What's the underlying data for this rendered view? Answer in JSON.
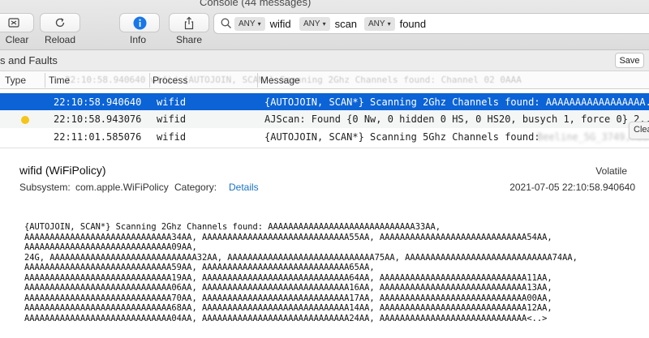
{
  "window": {
    "title": "Console (44 messages)"
  },
  "toolbar": {
    "clear_label": "Clear",
    "reload_label": "Reload",
    "info_label": "Info",
    "share_label": "Share"
  },
  "search": {
    "tokens": [
      {
        "scope": "ANY",
        "text": "wifid"
      },
      {
        "scope": "ANY",
        "text": "scan"
      },
      {
        "scope": "ANY",
        "text": "found"
      }
    ]
  },
  "header": {
    "faults_label": "s and Faults",
    "save_label": "Save"
  },
  "table": {
    "columns": [
      "Type",
      "Time",
      "Process",
      "Message"
    ],
    "rows": [
      {
        "type": "",
        "time": "22:10:58.940640",
        "process": "wifid",
        "message": "{AUTOJOIN, SCAN*} Scanning 2Ghz Channels found: AAAAAAAAAAAAAAAAA..."
      },
      {
        "type": "yellow-dot",
        "time": "22:10:58.943076",
        "process": "wifid",
        "message": "AJScan: Found {0 Nw, 0 hidden 0 HS, 0 HS20, busych 1, force 0} 2..."
      },
      {
        "type": "",
        "time": "22:11:01.585076",
        "process": "wifid",
        "message": "{AUTOJOIN, SCAN*} Scanning 5Ghz Channels found:"
      }
    ]
  },
  "details": {
    "title": "wifid (WiFiPolicy)",
    "volatile": "Volatile",
    "subsystem_label": "Subsystem:",
    "subsystem_value": "com.apple.WiFiPolicy",
    "category_label": "Category:",
    "details_link": "Details",
    "timestamp": "2021-07-05 22:10:58.940640",
    "message_lines": [
      "{AUTOJOIN, SCAN*} Scanning 2Ghz Channels found: AAAAAAAAAAAAAAAAAAAAAAAAAAAAA33AA,",
      "AAAAAAAAAAAAAAAAAAAAAAAAAAAAA34AA, AAAAAAAAAAAAAAAAAAAAAAAAAAAAA55AA, AAAAAAAAAAAAAAAAAAAAAAAAAAAAA54AA,",
      "AAAAAAAAAAAAAAAAAAAAAAAAAAAAA09AA,",
      "24G, AAAAAAAAAAAAAAAAAAAAAAAAAAAAA32AA, AAAAAAAAAAAAAAAAAAAAAAAAAAAAA75AA, AAAAAAAAAAAAAAAAAAAAAAAAAAAAA74AA,",
      "AAAAAAAAAAAAAAAAAAAAAAAAAAAAA59AA, AAAAAAAAAAAAAAAAAAAAAAAAAAAAA65AA,",
      "AAAAAAAAAAAAAAAAAAAAAAAAAAAAA19AA, AAAAAAAAAAAAAAAAAAAAAAAAAAAAA64AA, AAAAAAAAAAAAAAAAAAAAAAAAAAAAA11AA,",
      "AAAAAAAAAAAAAAAAAAAAAAAAAAAAA06AA, AAAAAAAAAAAAAAAAAAAAAAAAAAAAA16AA, AAAAAAAAAAAAAAAAAAAAAAAAAAAAA13AA,",
      "AAAAAAAAAAAAAAAAAAAAAAAAAAAAA70AA, AAAAAAAAAAAAAAAAAAAAAAAAAAAAA17AA, AAAAAAAAAAAAAAAAAAAAAAAAAAAAA00AA,",
      "AAAAAAAAAAAAAAAAAAAAAAAAAAAAA68AA, AAAAAAAAAAAAAAAAAAAAAAAAAAAAA14AA, AAAAAAAAAAAAAAAAAAAAAAAAAAAAA12AA,",
      "AAAAAAAAAAAAAAAAAAAAAAAAAAAAA04AA, AAAAAAAAAAAAAAAAAAAAAAAAAAAAA24AA, AAAAAAAAAAAAAAAAAAAAAAAAAAAAA<..>"
    ],
    "clear_overlay": "Clea"
  },
  "colors": {
    "selection": "#0b63d6",
    "link": "#1a73c8",
    "warning_dot": "#f5c518"
  },
  "icons": [
    "clear-icon",
    "reload-icon",
    "info-icon",
    "share-icon",
    "search-icon"
  ]
}
